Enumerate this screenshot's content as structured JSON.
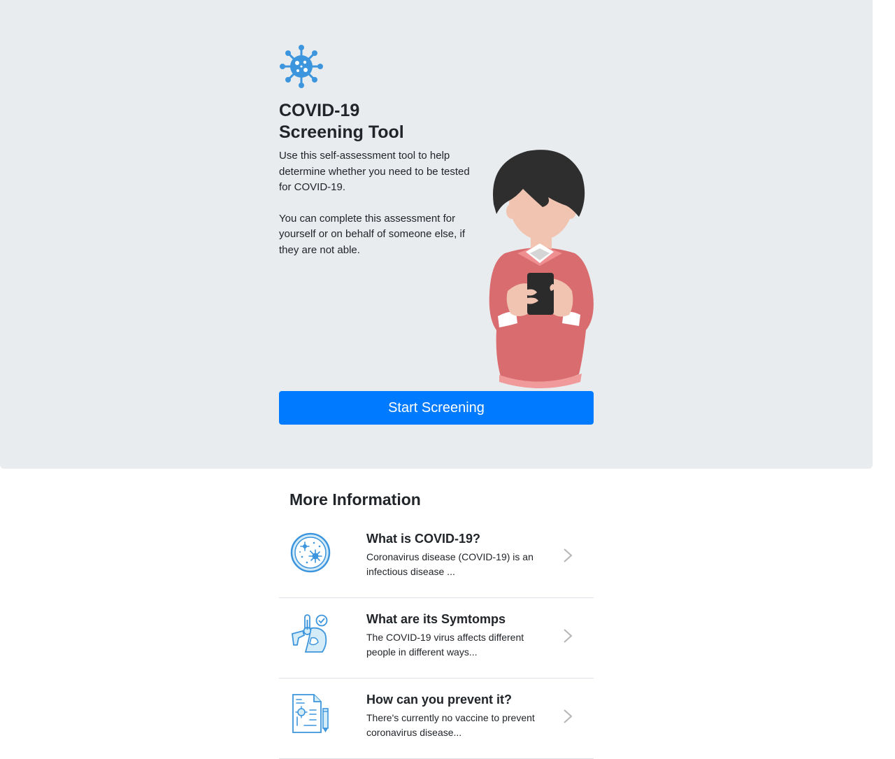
{
  "hero": {
    "logo_icon": "virus-icon",
    "title_line1": "COVID-19",
    "title_line2": "Screening Tool",
    "description_p1": "Use this self-assessment tool to help determine whether you need to be tested for COVID-19.",
    "description_p2": "You can complete this assessment for yourself or on behalf of someone else, if they are not able.",
    "illustration": "person-holding-phone",
    "start_button": "Start Screening"
  },
  "more_info": {
    "title": "More Information",
    "items": [
      {
        "heading": "What is COVID-19?",
        "text": "Coronavirus disease (COVID-19) is an infectious disease ...",
        "icon": "virus-petri-dish-icon"
      },
      {
        "heading": "What are its Symtomps",
        "text": "The COVID-19 virus affects different people in different ways...",
        "icon": "symptoms-thermometer-icon"
      },
      {
        "heading": "How can you prevent it?",
        "text": "There's currently no vaccine to prevent coronavirus disease...",
        "icon": "prevention-document-icon"
      }
    ]
  },
  "colors": {
    "hero_background": "#e9ecef",
    "primary": "#007bff",
    "icon_blue": "#3d96dd",
    "sweater": "#d96c6f"
  }
}
